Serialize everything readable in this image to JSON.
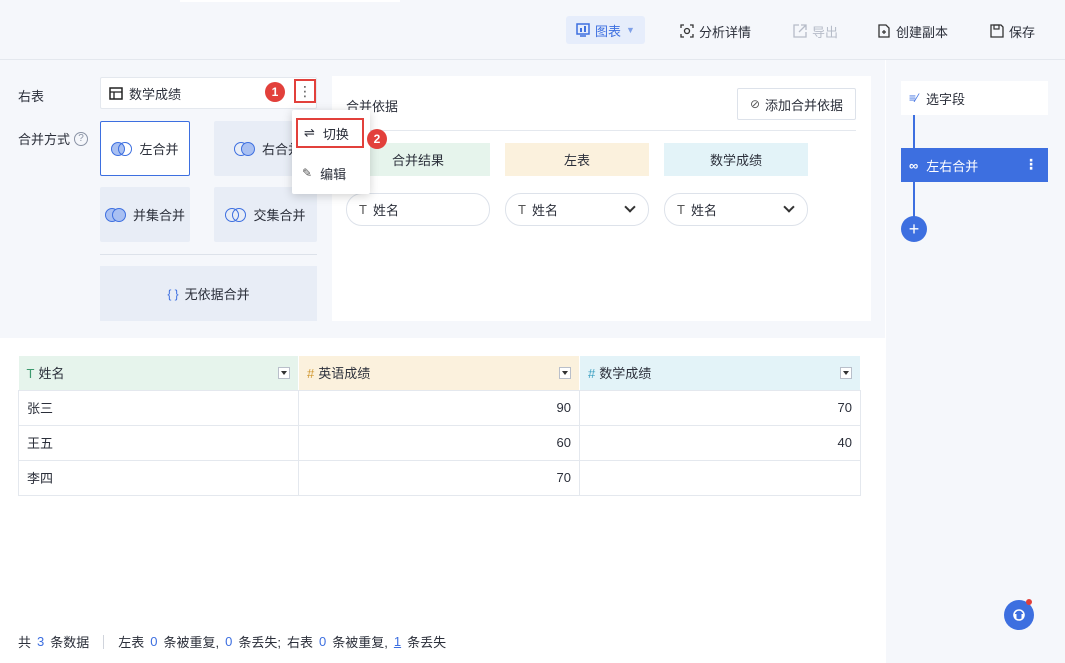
{
  "toolbar": {
    "chart_label": "图表",
    "analysis_label": "分析详情",
    "export_label": "导出",
    "duplicate_label": "创建副本",
    "save_label": "保存"
  },
  "config": {
    "right_table_label": "右表",
    "right_table_value": "数学成绩",
    "merge_mode_label": "合并方式",
    "merge_types": [
      "左合并",
      "右合并",
      "并集合并",
      "交集合并"
    ],
    "no_basis_merge": "无依据合并",
    "basis_title": "合并依据",
    "add_basis": "添加合并依据",
    "headers": [
      "合并结果",
      "左表",
      "数学成绩"
    ],
    "fields": [
      "姓名",
      "姓名",
      "姓名"
    ]
  },
  "badges": [
    "1",
    "2"
  ],
  "popup": {
    "items": [
      "切换",
      "编辑"
    ]
  },
  "flow": {
    "step1": "选字段",
    "step2": "左右合并",
    "add": "+"
  },
  "grid": {
    "headers": [
      "姓名",
      "英语成绩",
      "数学成绩"
    ],
    "types": [
      "T",
      "#",
      "#"
    ],
    "rows": [
      [
        "张三",
        "90",
        "70"
      ],
      [
        "王五",
        "60",
        "40"
      ],
      [
        "李四",
        "70",
        ""
      ]
    ]
  },
  "footer": {
    "t1": "共",
    "count": "3",
    "t2": "条数据",
    "left_label": "左表",
    "left_dup": "0",
    "t3": "条被重复,",
    "left_lost": "0",
    "t4": "条丢失;",
    "right_label": "右表",
    "right_dup": "0",
    "t5": "条被重复,",
    "right_lost": "1",
    "t6": "条丢失"
  },
  "colors": {
    "accent": "#3d6fe0",
    "highlight": "#e2403b",
    "hdr_result": "#e6f4ec",
    "hdr_left": "#fbf1dd",
    "hdr_right": "#e3f3f8"
  }
}
